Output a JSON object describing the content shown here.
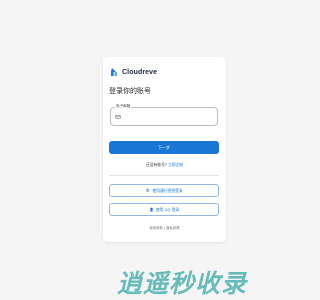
{
  "brand": {
    "name": "Cloudreve",
    "icon": "cloudreve-logo-icon",
    "color": "#1976d2"
  },
  "login": {
    "title": "登录你的账号",
    "email_label": "电子邮箱",
    "email_value": "",
    "email_icon": "email-icon",
    "next_label": "下一步",
    "signup_prompt": "还没有账号?",
    "signup_link": "立即注册",
    "passkey_label": "使用通行密钥登录",
    "passkey_icon": "fingerprint-icon",
    "qq_label": "使用 QQ 登录",
    "qq_icon": "qq-icon"
  },
  "footer": {
    "terms": "使用条款",
    "separator": "|",
    "privacy": "隐私政策"
  },
  "watermark": {
    "text": "逍遥秒收录",
    "color": "#2aa4a0"
  }
}
